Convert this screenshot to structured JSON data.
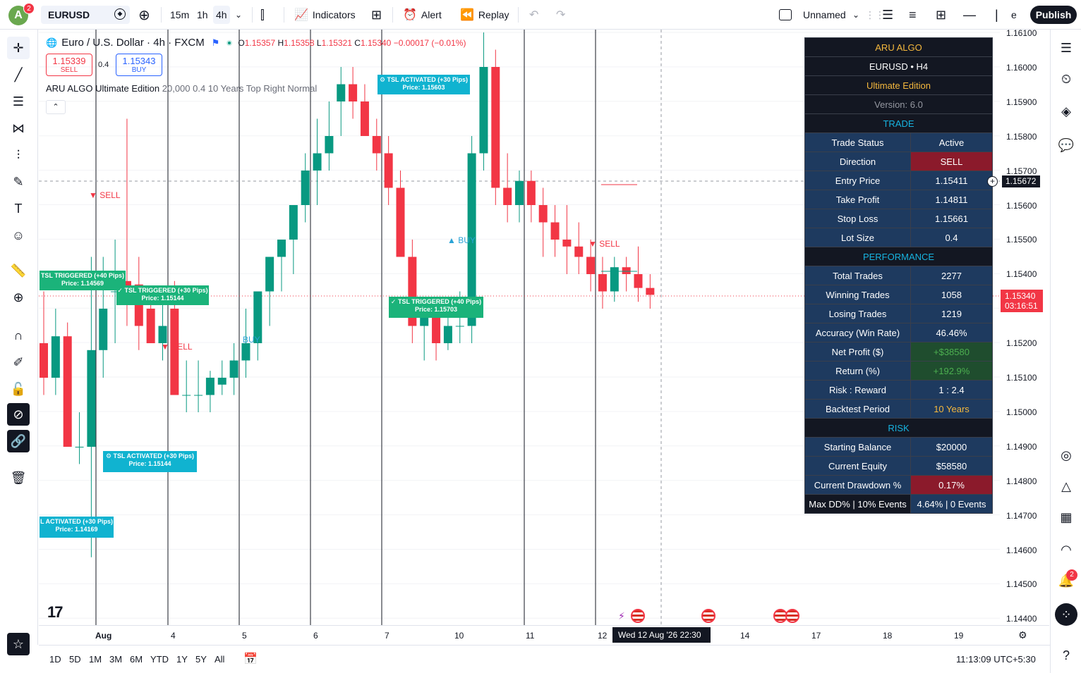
{
  "toolbar": {
    "avatar_letter": "A",
    "avatar_badge": "2",
    "symbol": "EURUSD",
    "timeframes": [
      "15m",
      "1h",
      "4h"
    ],
    "indicators_label": "Indicators",
    "alert_label": "Alert",
    "replay_label": "Replay",
    "layout_name": "Unnamed",
    "truncated_label": "e",
    "publish_label": "Publish"
  },
  "legend": {
    "title": "Euro / U.S. Dollar · 4h · FXCM",
    "open_key": "O",
    "open": "1.15357",
    "high_key": "H",
    "high": "1.15358",
    "low_key": "L",
    "low": "1.15321",
    "close_key": "C",
    "close": "1.15340",
    "change": "−0.00017 (−0.01%)",
    "sell_price": "1.15339",
    "sell_label": "SELL",
    "buy_price": "1.15343",
    "buy_label": "BUY",
    "spread": "0.4",
    "indicator_name": "ARU ALGO Ultimate Edition",
    "indicator_params": "20,000 0.4 10 Years Top Right Normal",
    "collapse_glyph": "⌃"
  },
  "price_scale": {
    "labels": [
      "1.16100",
      "1.16000",
      "1.15900",
      "1.15800",
      "1.15700",
      "1.15600",
      "1.15500",
      "1.15400",
      "1.15300",
      "1.15200",
      "1.15100",
      "1.15000",
      "1.14900",
      "1.14800",
      "1.14700",
      "1.14600",
      "1.14500",
      "1.14400"
    ],
    "crosshair_price": "1.15672",
    "current_price": "1.15340",
    "countdown": "03:16:51"
  },
  "time_axis": {
    "labels": [
      "Aug",
      "4",
      "5",
      "6",
      "7",
      "10",
      "11",
      "12",
      "14",
      "17",
      "18",
      "19"
    ],
    "crosshair_time": "Wed 12 Aug '26   22:30"
  },
  "bottom": {
    "ranges": [
      "1D",
      "5D",
      "1M",
      "3M",
      "6M",
      "YTD",
      "1Y",
      "5Y",
      "All"
    ],
    "clock": "11:13:09 UTC+5:30"
  },
  "panel": {
    "title": "ARU ALGO",
    "subtitle": "EURUSD • H4",
    "edition": "Ultimate Edition",
    "version": "Version: 6.0",
    "sec_trade": "TRADE",
    "sec_perf": "PERFORMANCE",
    "sec_risk": "RISK",
    "trade_rows": [
      {
        "k": "Trade Status",
        "v": "Active"
      },
      {
        "k": "Direction",
        "v": "SELL"
      },
      {
        "k": "Entry Price",
        "v": "1.15411"
      },
      {
        "k": "Take Profit",
        "v": "1.14811"
      },
      {
        "k": "Stop Loss",
        "v": "1.15661"
      },
      {
        "k": "Lot Size",
        "v": "0.4"
      }
    ],
    "perf_rows": [
      {
        "k": "Total Trades",
        "v": "2277"
      },
      {
        "k": "Winning Trades",
        "v": "1058"
      },
      {
        "k": "Losing Trades",
        "v": "1219"
      },
      {
        "k": "Accuracy (Win Rate)",
        "v": "46.46%"
      },
      {
        "k": "Net Profit ($)",
        "v": "+$38580"
      },
      {
        "k": "Return (%)",
        "v": "+192.9%"
      },
      {
        "k": "Risk : Reward",
        "v": "1 : 2.4"
      },
      {
        "k": "Backtest Period",
        "v": "10 Years"
      }
    ],
    "risk_rows": [
      {
        "k": "Starting Balance",
        "v": "$20000"
      },
      {
        "k": "Current Equity",
        "v": "$58580"
      },
      {
        "k": "Current Drawdown %",
        "v": "0.17%"
      },
      {
        "k": "Max DD% | 10% Events",
        "v": "4.64% | 0 Events"
      }
    ]
  },
  "annotations": {
    "tsl_act_1": "⚙ TSL ACTIVATED (+30 Pips)",
    "tsl_act_1_price": "Price: 1.15603",
    "tsl_trig_1": "TSL TRIGGERED (+40 Pips)",
    "tsl_trig_1_price": "Price: 1.14569",
    "tsl_trig_2": "✓ TSL TRIGGERED (+30 Pips)",
    "tsl_trig_2_price": "Price: 1.15144",
    "tsl_trig_3": "✓ TSL TRIGGERED (+40 Pips)",
    "tsl_trig_3_price": "Price: 1.15703",
    "tsl_act_2": "⚙ TSL ACTIVATED (+30 Pips)",
    "tsl_act_2_price": "Price: 1.15144",
    "tsl_act_3": "L ACTIVATED (+30 Pips)",
    "tsl_act_3_price": "Price: 1.14169",
    "sell_signal": "SELL",
    "buy_signal": "BUY"
  },
  "chart_data": {
    "type": "candlestick",
    "price_range": [
      1.1435,
      1.1615
    ],
    "colors": {
      "up": "#089981",
      "down": "#f23645"
    },
    "candles": [
      {
        "o": 1.152,
        "h": 1.1535,
        "l": 1.1505,
        "c": 1.151
      },
      {
        "o": 1.151,
        "h": 1.153,
        "l": 1.1505,
        "c": 1.1522
      },
      {
        "o": 1.1522,
        "h": 1.1526,
        "l": 1.1505,
        "c": 1.149
      },
      {
        "o": 1.149,
        "h": 1.15,
        "l": 1.1485,
        "c": 1.149
      },
      {
        "o": 1.149,
        "h": 1.1545,
        "l": 1.1458,
        "c": 1.1518
      },
      {
        "o": 1.1518,
        "h": 1.1545,
        "l": 1.151,
        "c": 1.153
      },
      {
        "o": 1.1535,
        "h": 1.155,
        "l": 1.152,
        "c": 1.1535
      },
      {
        "o": 1.1538,
        "h": 1.1585,
        "l": 1.1525,
        "c": 1.1535
      },
      {
        "o": 1.1537,
        "h": 1.1545,
        "l": 1.1518,
        "c": 1.1525
      },
      {
        "o": 1.153,
        "h": 1.1535,
        "l": 1.152,
        "c": 1.152
      },
      {
        "o": 1.152,
        "h": 1.1535,
        "l": 1.1515,
        "c": 1.1525
      },
      {
        "o": 1.153,
        "h": 1.1538,
        "l": 1.1505,
        "c": 1.1505
      },
      {
        "o": 1.1505,
        "h": 1.1515,
        "l": 1.15,
        "c": 1.1505
      },
      {
        "o": 1.1505,
        "h": 1.1515,
        "l": 1.15,
        "c": 1.1505
      },
      {
        "o": 1.1505,
        "h": 1.1512,
        "l": 1.15,
        "c": 1.151
      },
      {
        "o": 1.1508,
        "h": 1.1515,
        "l": 1.1505,
        "c": 1.151
      },
      {
        "o": 1.151,
        "h": 1.152,
        "l": 1.1505,
        "c": 1.1515
      },
      {
        "o": 1.1515,
        "h": 1.153,
        "l": 1.151,
        "c": 1.152
      },
      {
        "o": 1.152,
        "h": 1.1535,
        "l": 1.1515,
        "c": 1.1535
      },
      {
        "o": 1.1535,
        "h": 1.1545,
        "l": 1.1525,
        "c": 1.1545
      },
      {
        "o": 1.1545,
        "h": 1.155,
        "l": 1.1535,
        "c": 1.155
      },
      {
        "o": 1.155,
        "h": 1.156,
        "l": 1.154,
        "c": 1.156
      },
      {
        "o": 1.156,
        "h": 1.1575,
        "l": 1.1555,
        "c": 1.157
      },
      {
        "o": 1.157,
        "h": 1.1585,
        "l": 1.156,
        "c": 1.1575
      },
      {
        "o": 1.1575,
        "h": 1.159,
        "l": 1.157,
        "c": 1.158
      },
      {
        "o": 1.159,
        "h": 1.16,
        "l": 1.158,
        "c": 1.1595
      },
      {
        "o": 1.1595,
        "h": 1.16,
        "l": 1.1585,
        "c": 1.159
      },
      {
        "o": 1.159,
        "h": 1.1595,
        "l": 1.158,
        "c": 1.158
      },
      {
        "o": 1.158,
        "h": 1.1585,
        "l": 1.157,
        "c": 1.1575
      },
      {
        "o": 1.1575,
        "h": 1.158,
        "l": 1.156,
        "c": 1.1565
      },
      {
        "o": 1.1565,
        "h": 1.157,
        "l": 1.1545,
        "c": 1.1545
      },
      {
        "o": 1.1545,
        "h": 1.155,
        "l": 1.152,
        "c": 1.1525
      },
      {
        "o": 1.1525,
        "h": 1.153,
        "l": 1.1515,
        "c": 1.1528
      },
      {
        "o": 1.1528,
        "h": 1.1532,
        "l": 1.1515,
        "c": 1.152
      },
      {
        "o": 1.152,
        "h": 1.153,
        "l": 1.1518,
        "c": 1.1525
      },
      {
        "o": 1.1525,
        "h": 1.1535,
        "l": 1.152,
        "c": 1.1525
      },
      {
        "o": 1.1525,
        "h": 1.158,
        "l": 1.152,
        "c": 1.1575
      },
      {
        "o": 1.1575,
        "h": 1.161,
        "l": 1.157,
        "c": 1.16
      },
      {
        "o": 1.16,
        "h": 1.1605,
        "l": 1.156,
        "c": 1.1565
      },
      {
        "o": 1.1565,
        "h": 1.1575,
        "l": 1.1555,
        "c": 1.156
      },
      {
        "o": 1.156,
        "h": 1.157,
        "l": 1.1555,
        "c": 1.1567
      },
      {
        "o": 1.1567,
        "h": 1.157,
        "l": 1.1555,
        "c": 1.156
      },
      {
        "o": 1.156,
        "h": 1.1565,
        "l": 1.1545,
        "c": 1.1555
      },
      {
        "o": 1.1555,
        "h": 1.156,
        "l": 1.1545,
        "c": 1.155
      },
      {
        "o": 1.155,
        "h": 1.156,
        "l": 1.154,
        "c": 1.1548
      },
      {
        "o": 1.1548,
        "h": 1.1555,
        "l": 1.154,
        "c": 1.1545
      },
      {
        "o": 1.1545,
        "h": 1.155,
        "l": 1.1535,
        "c": 1.154
      },
      {
        "o": 1.154,
        "h": 1.1545,
        "l": 1.153,
        "c": 1.1535
      },
      {
        "o": 1.1535,
        "h": 1.1545,
        "l": 1.1532,
        "c": 1.1542
      },
      {
        "o": 1.1542,
        "h": 1.1545,
        "l": 1.1535,
        "c": 1.154
      },
      {
        "o": 1.154,
        "h": 1.1548,
        "l": 1.1532,
        "c": 1.1536
      },
      {
        "o": 1.1536,
        "h": 1.154,
        "l": 1.153,
        "c": 1.1534
      }
    ]
  }
}
